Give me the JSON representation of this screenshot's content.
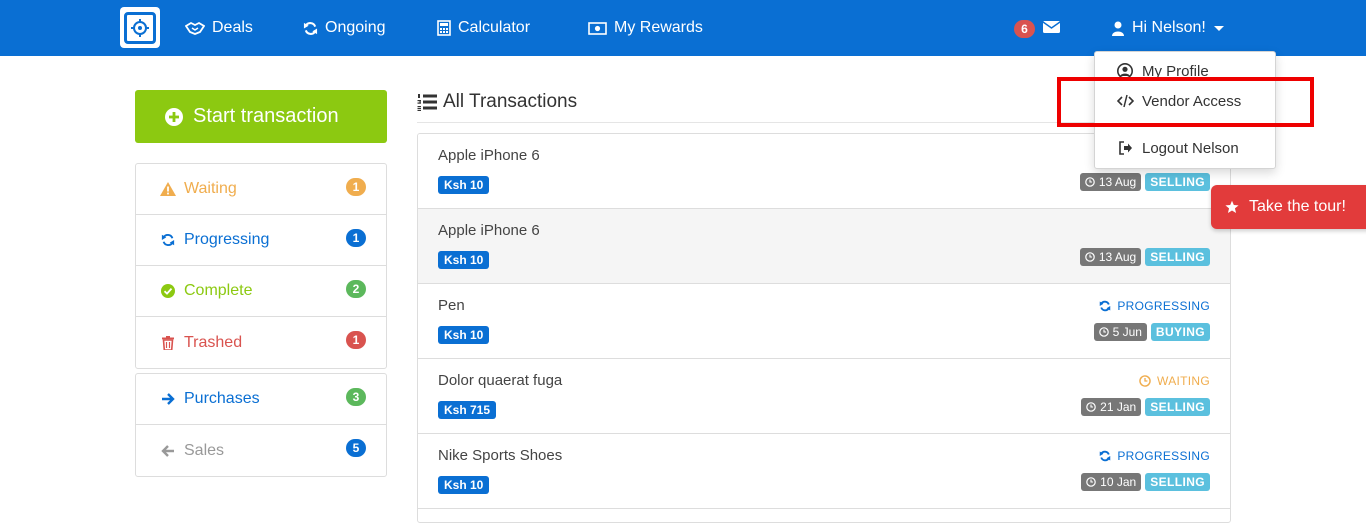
{
  "colors": {
    "brand": "#0a6fd3",
    "start": "#8cc911",
    "waiting": "#f0ad4e",
    "progressing": "#0a6fd3",
    "complete": "#8cc911",
    "trashed": "#d9534f",
    "purchases": "#0a6fd3",
    "sales": "#999999",
    "badge_green": "#5cb85c",
    "tour": "#e23b3b"
  },
  "navbar": {
    "logo_icon": "safe-icon",
    "links": [
      {
        "label": "Deals",
        "icon": "handshake-icon"
      },
      {
        "label": "Ongoing",
        "icon": "refresh-icon"
      },
      {
        "label": "Calculator",
        "icon": "calculator-icon"
      },
      {
        "label": "My Rewards",
        "icon": "money-icon"
      }
    ],
    "messages_count": "6",
    "envelope_icon": "envelope-icon",
    "user_greeting": "Hi Nelson!"
  },
  "dropdown": {
    "items": [
      {
        "label": "My Profile",
        "icon": "user-circle-icon"
      },
      {
        "label": "Vendor Access",
        "icon": "code-icon"
      },
      {
        "label": "Logout Nelson",
        "icon": "sign-out-icon"
      }
    ]
  },
  "sidebar": {
    "start_label": "Start transaction",
    "filters": [
      {
        "label": "Waiting",
        "count": "1",
        "icon": "warning-icon"
      },
      {
        "label": "Progressing",
        "count": "1",
        "icon": "refresh-icon"
      },
      {
        "label": "Complete",
        "count": "2",
        "icon": "check-circle-icon"
      },
      {
        "label": "Trashed",
        "count": "1",
        "icon": "trash-icon"
      }
    ],
    "directions": [
      {
        "label": "Purchases",
        "count": "3",
        "icon": "arrow-right-icon"
      },
      {
        "label": "Sales",
        "count": "5",
        "icon": "arrow-left-icon"
      }
    ]
  },
  "main": {
    "title": "All Transactions",
    "title_icon": "ordered-list-icon",
    "transactions": [
      {
        "name": "Apple iPhone 6",
        "price": "Ksh 10",
        "status": "",
        "date": "13 Aug",
        "role": "SELLING"
      },
      {
        "name": "Apple iPhone 6",
        "price": "Ksh 10",
        "status": "",
        "date": "13 Aug",
        "role": "SELLING"
      },
      {
        "name": "Pen",
        "price": "Ksh 10",
        "status": "PROGRESSING",
        "date": "5 Jun",
        "role": "BUYING"
      },
      {
        "name": "Dolor quaerat fuga",
        "price": "Ksh 715",
        "status": "WAITING",
        "date": "21 Jan",
        "role": "SELLING"
      },
      {
        "name": "Nike Sports Shoes",
        "price": "Ksh 10",
        "status": "PROGRESSING",
        "date": "10 Jan",
        "role": "SELLING"
      }
    ]
  },
  "tour": {
    "label": "Take the tour!",
    "icon": "star-icon"
  }
}
